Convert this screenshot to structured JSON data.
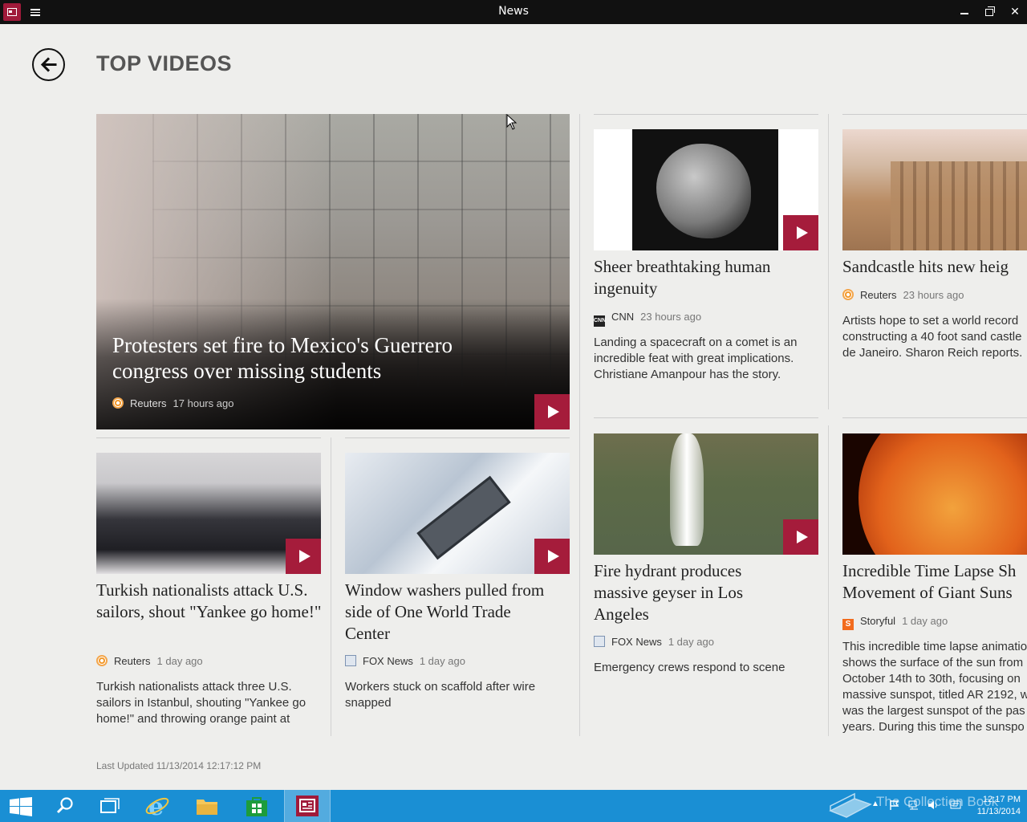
{
  "window": {
    "title": "News"
  },
  "header": {
    "title": "TOP VIDEOS"
  },
  "hero": {
    "headline": "Protesters set fire to Mexico's Guerrero congress over missing students",
    "source": "Reuters",
    "time": "17 hours ago"
  },
  "cards": [
    {
      "headline": "Sheer breathtaking human ingenuity",
      "source": "CNN",
      "time": "23 hours ago",
      "description": "Landing a spacecraft on a comet is an incredible feat with great implications. Christiane Amanpour has the story."
    },
    {
      "headline": "Sandcastle hits new heig",
      "source": "Reuters",
      "time": "23 hours ago",
      "description": "Artists hope to set a world record constructing a 40 foot sand castle de Janeiro. Sharon Reich reports."
    },
    {
      "headline": "Turkish nationalists attack U.S. sailors, shout \"Yankee go home!\"",
      "source": "Reuters",
      "time": "1 day ago",
      "description": "Turkish nationalists attack three U.S. sailors in Istanbul, shouting \"Yankee go home!\" and throwing orange paint at"
    },
    {
      "headline": "Window washers pulled from side of One World Trade Center",
      "source": "FOX News",
      "time": "1 day ago",
      "description": "Workers stuck on scaffold after wire snapped"
    },
    {
      "headline": "Fire hydrant produces massive geyser in Los Angeles",
      "source": "FOX News",
      "time": "1 day ago",
      "description": "Emergency crews respond to scene"
    },
    {
      "headline": "Incredible Time Lapse Sh Movement of Giant Suns",
      "source": "Storyful",
      "time": "1 day ago",
      "description": "This incredible time lapse animatio shows the surface of the sun from October 14th to 30th, focusing on massive sunspot, titled AR 2192, w was the largest sunspot of the pas years. During this time the sunspo"
    }
  ],
  "footer": {
    "last_updated": "Last Updated 11/13/2014 12:17:12 PM"
  },
  "taskbar": {
    "clock_time": "12:17 PM",
    "clock_date": "11/13/2014",
    "watermark": "The Collection Book"
  },
  "colors": {
    "accent": "#a51c3b",
    "taskbar": "#1a8fd4",
    "titlebar": "#111111",
    "background": "#eeeeec"
  }
}
